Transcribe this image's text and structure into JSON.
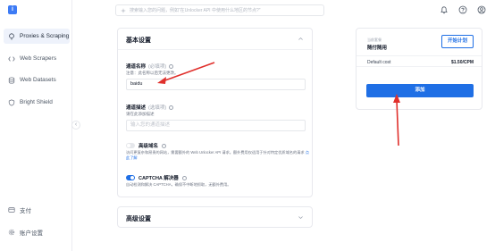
{
  "sidebar": {
    "logo": "i",
    "items": [
      {
        "label": "Proxies & Scraping",
        "icon": "proxy-icon"
      },
      {
        "label": "Web Scrapers",
        "icon": "code-icon"
      },
      {
        "label": "Web Datasets",
        "icon": "database-icon"
      },
      {
        "label": "Bright Shield",
        "icon": "shield-icon"
      }
    ],
    "bottom_items": [
      {
        "label": "支付",
        "icon": "card-icon"
      },
      {
        "label": "账户设置",
        "icon": "gear-icon"
      }
    ]
  },
  "topbar": {
    "search_placeholder": "搜索输入您的问题，例如“在Unlocker API 中使用什么地区的节点?”"
  },
  "main": {
    "section_title": "基本设置",
    "channel_name": {
      "label": "通道名称",
      "optional": "(必填项)",
      "hint": "注意：此名称以后无法更改。",
      "value": "baidu"
    },
    "channel_desc": {
      "label": "通道描述",
      "optional": "(选填项)",
      "hint": "请在此添加描述",
      "placeholder": "输入您的通道描述"
    },
    "premium_domains": {
      "label": "高级域名",
      "description": "访问更复杂和昂贵的网站，需要额外的 Web Unlocker API 请求。额外费用仅适用于针对特定优质域名的请求",
      "link": "点此了解"
    },
    "captcha": {
      "label": "CAPTCHA 解决器",
      "description": "自动检测和解决 CAPTCHA，确保不中断地抓取，无额外费用。"
    },
    "advanced_title": "高级设置"
  },
  "plan_card": {
    "plan_label": "当前套餐",
    "plan_name": "随付随用",
    "upgrade_label": "开始计划",
    "cost_label": "Default cost",
    "cost_value": "$1.50/CPM",
    "add_label": "添加"
  },
  "colors": {
    "accent": "#1f6fe5",
    "annotation": "#e0302c"
  }
}
